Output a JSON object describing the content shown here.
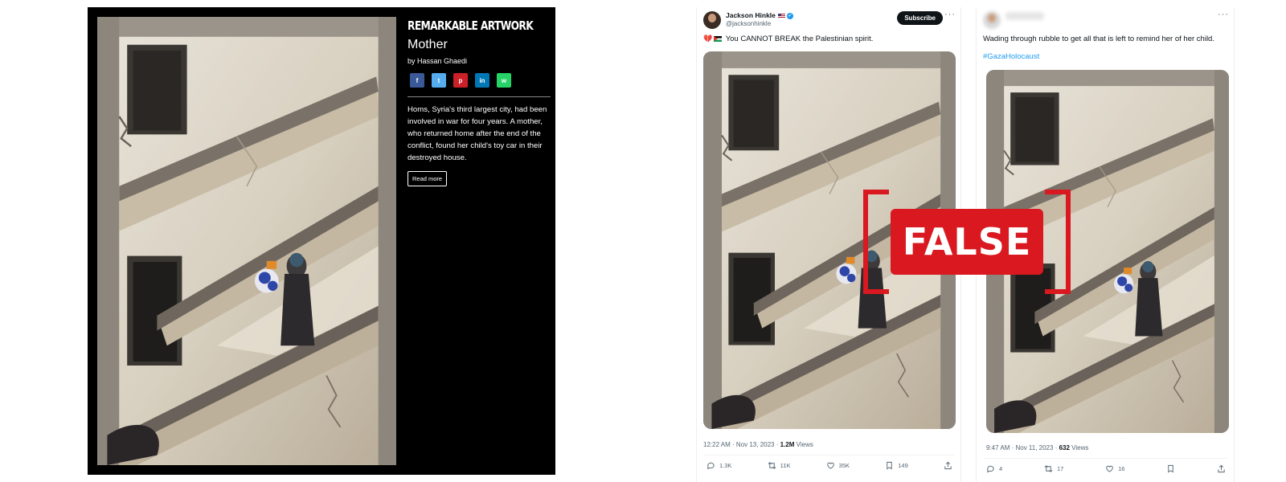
{
  "artwork": {
    "heading": "REMARKABLE ARTWORK",
    "title": "Mother",
    "author": "by Hassan Ghaedi",
    "share": [
      {
        "icon": "facebook-icon",
        "glyph": "f",
        "color": "#3b5998"
      },
      {
        "icon": "twitter-icon",
        "glyph": "t",
        "color": "#55acee"
      },
      {
        "icon": "pinterest-icon",
        "glyph": "p",
        "color": "#cb2027"
      },
      {
        "icon": "linkedin-icon",
        "glyph": "in",
        "color": "#0077b5"
      },
      {
        "icon": "whatsapp-icon",
        "glyph": "w",
        "color": "#25d366"
      }
    ],
    "description": "Homs, Syria's third largest city, had been involved in war for four years. A mother, who returned home after the end of the conflict, found her child's toy car in their destroyed house.",
    "read_more": "Read more"
  },
  "tweet1": {
    "name": "Jackson Hinkle",
    "handle": "@jacksonhinkle",
    "subscribe": "Subscribe",
    "text": "You CANNOT BREAK the Palestinian spirit.",
    "time": "12:22 AM · Nov 13, 2023 ·",
    "views": "1.2M",
    "views_label": "Views",
    "replies": "1.3K",
    "reposts": "11K",
    "likes": "35K",
    "bookmarks": "149"
  },
  "tweet2": {
    "text": "Wading through rubble to get all that  is left to remind her of her child.",
    "hashtag": "#GazaHolocaust",
    "time": "9:47 AM · Nov 11, 2023 ·",
    "views": "632",
    "views_label": "Views",
    "replies": "4",
    "reposts": "17",
    "likes": "16"
  },
  "stamp": {
    "label": "FALSE",
    "color": "#d9181f"
  }
}
